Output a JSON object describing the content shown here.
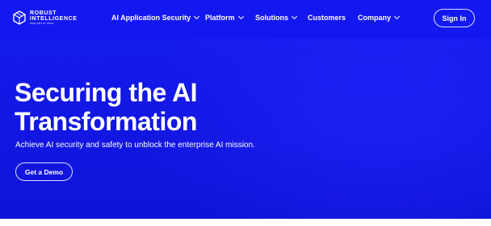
{
  "brand": {
    "name_line1": "ROBUST",
    "name_line2": "INTELLIGENCE",
    "tagline": "now part of cisco",
    "logo_icon": "hexagon-cube-icon"
  },
  "nav": {
    "items": [
      {
        "label": "AI Application Security",
        "has_dropdown": true
      },
      {
        "label": "Platform",
        "has_dropdown": true
      },
      {
        "label": "Solutions",
        "has_dropdown": true
      },
      {
        "label": "Customers",
        "has_dropdown": false
      },
      {
        "label": "Company",
        "has_dropdown": true
      }
    ],
    "signin_label": "Sign In"
  },
  "hero": {
    "headline_line1": "Securing the AI",
    "headline_line2": "Transformation",
    "subhead": "Achieve AI security and safety to unblock the enterprise AI mission.",
    "cta_label": "Get a Demo"
  },
  "colors": {
    "hero_blue": "#1418f0",
    "text": "#ffffff"
  }
}
